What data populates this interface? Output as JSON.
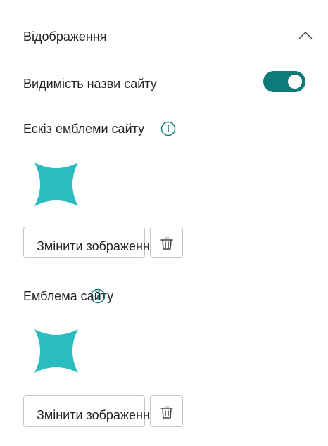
{
  "section": {
    "title": "Відображення"
  },
  "site_name_visibility": {
    "label": "Видимість назви сайту",
    "enabled": true
  },
  "thumbnail": {
    "label": "Ескіз емблеми сайту",
    "change_label": "Змінити зображення"
  },
  "logo": {
    "label": "Емблема сайту",
    "change_label": "Змінити зображення"
  },
  "colors": {
    "accent": "#0f7a7a",
    "logo": "#2bbcbf",
    "text": "#242424",
    "border": "#c8c6c4"
  },
  "icons": {
    "collapse": "chevron-up-icon",
    "info": "info-icon",
    "delete": "trash-icon",
    "logo": "four-point-star-icon"
  }
}
